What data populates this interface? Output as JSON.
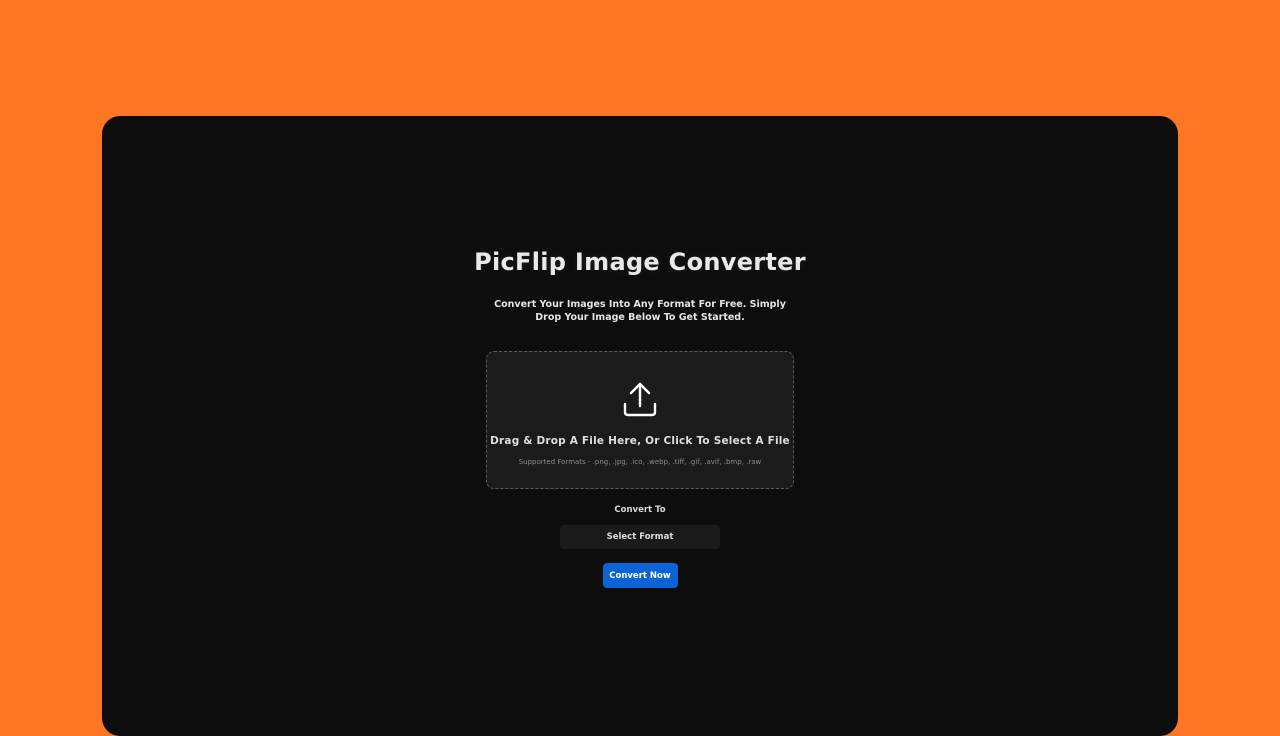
{
  "app": {
    "title": "PicFlip Image Converter",
    "subtitle": "Convert Your Images Into Any Format For Free. Simply Drop Your Image Below To Get Started."
  },
  "dropzone": {
    "icon": "upload-icon",
    "instruction": "Drag & Drop A File Here, Or Click To Select A File",
    "supported_formats": "Supported Formats - .png, .jpg, .ico, .webp, .tiff, .gif, .avif, .bmp, .raw"
  },
  "convert": {
    "label": "Convert To",
    "select_value": "Select Format",
    "button_label": "Convert Now"
  },
  "colors": {
    "background": "#ff7624",
    "panel": "#0d0d0e",
    "dropzone": "#1b1b1c",
    "accent": "#0b63d8"
  }
}
